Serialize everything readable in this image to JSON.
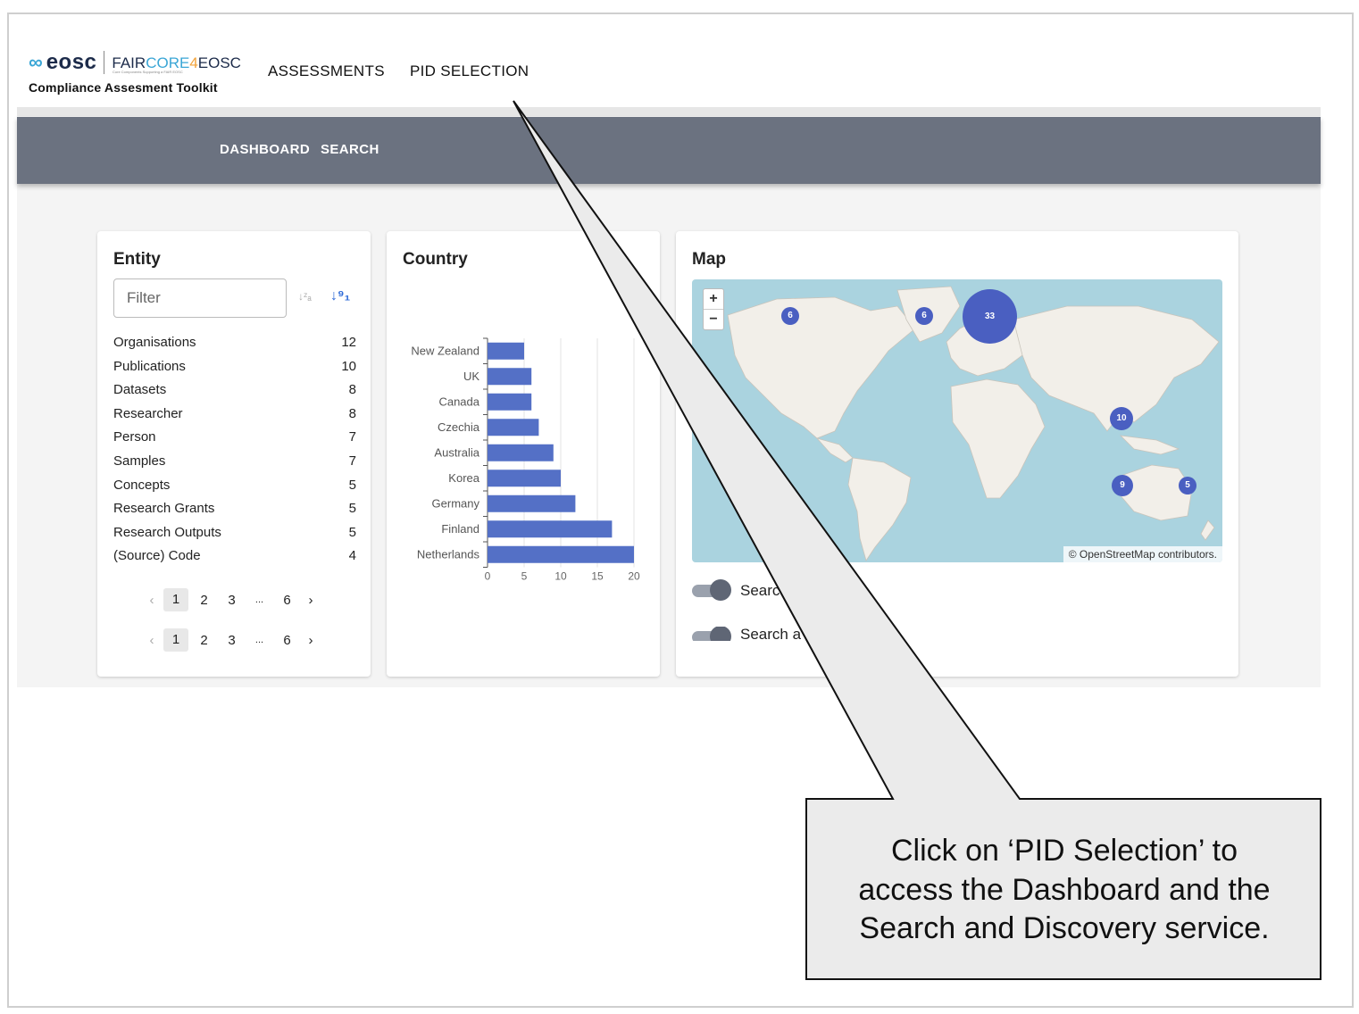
{
  "header": {
    "logo_brand": "eosc",
    "logo_fair_prefix": "FAIR",
    "logo_fair_core": "CORE",
    "logo_fair_four": "4",
    "logo_fair_suffix": "EOSC",
    "logo_tagline": "Core Components Supporting a FAIR EOSC",
    "logo_subtitle": "Compliance Assesment Toolkit",
    "nav": [
      "ASSESSMENTS",
      "PID SELECTION"
    ]
  },
  "subnav": {
    "items": [
      "DASHBOARD",
      "SEARCH"
    ]
  },
  "entity_card": {
    "title": "Entity",
    "filter_placeholder": "Filter",
    "sort_alpha_icon": "sort-alpha-icon",
    "sort_numeric_icon": "sort-numeric-icon",
    "rows": [
      {
        "label": "Organisations",
        "count": "12"
      },
      {
        "label": "Publications",
        "count": "10"
      },
      {
        "label": "Datasets",
        "count": "8"
      },
      {
        "label": "Researcher",
        "count": "8"
      },
      {
        "label": "Person",
        "count": "7"
      },
      {
        "label": "Samples",
        "count": "7"
      },
      {
        "label": "Concepts",
        "count": "5"
      },
      {
        "label": "Research Grants",
        "count": "5"
      },
      {
        "label": "Research Outputs",
        "count": "5"
      },
      {
        "label": "(Source) Code",
        "count": "4"
      }
    ],
    "pager": {
      "prev": "‹",
      "pages": [
        "1",
        "2",
        "3"
      ],
      "ellipsis": "...",
      "last": "6",
      "next": "›",
      "active": "1"
    }
  },
  "country_card": {
    "title": "Country"
  },
  "chart_data": {
    "type": "bar",
    "orientation": "horizontal",
    "categories": [
      "New Zealand",
      "UK",
      "Canada",
      "Czechia",
      "Australia",
      "Korea",
      "Germany",
      "Finland",
      "Netherlands"
    ],
    "values": [
      5,
      6,
      6,
      7,
      9,
      10,
      12,
      17,
      20
    ],
    "xlim": [
      0,
      20
    ],
    "xticks": [
      "0",
      "5",
      "10",
      "15",
      "20"
    ],
    "grid": true,
    "bar_color": "#5470c6"
  },
  "map_card": {
    "title": "Map",
    "zoom_in": "+",
    "zoom_out": "−",
    "clusters": [
      {
        "count": "6",
        "name": "north-america-cluster"
      },
      {
        "count": "6",
        "name": "greenland-cluster"
      },
      {
        "count": "33",
        "name": "europe-cluster"
      },
      {
        "count": "10",
        "name": "asia-cluster"
      },
      {
        "count": "9",
        "name": "australia-west-cluster"
      },
      {
        "count": "5",
        "name": "australia-east-cluster"
      }
    ],
    "attribution": "© OpenStreetMap contributors.",
    "toggle_label": "Searc",
    "toggle2_label": "Search a"
  },
  "callout": {
    "lines": [
      "Click on ‘PID Selection’ to",
      "access the Dashboard and the",
      "Search and Discovery service."
    ]
  }
}
